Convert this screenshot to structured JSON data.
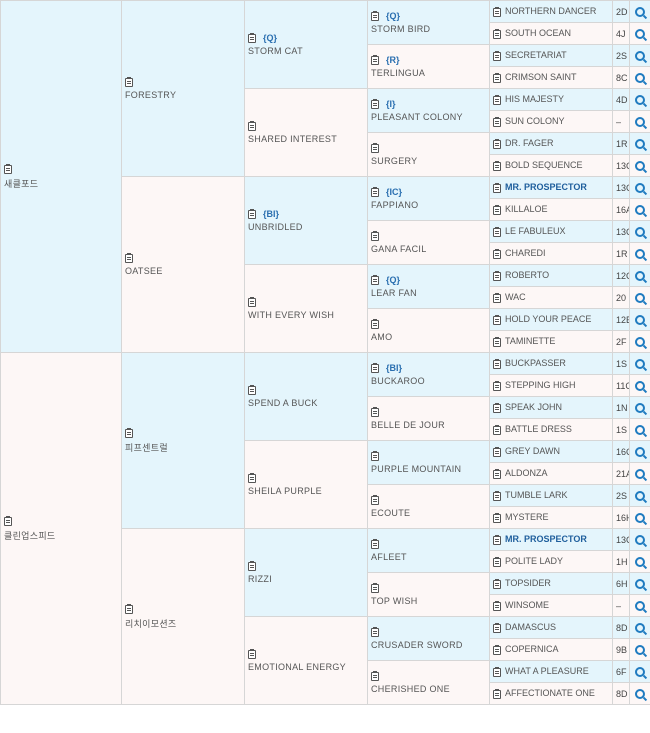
{
  "gen1": [
    {
      "name": "새클포드"
    },
    {
      "name": "클린업스피드"
    }
  ],
  "gen2": [
    {
      "name": "FORESTRY"
    },
    {
      "name": "OATSEE"
    },
    {
      "name": "피프센트럴"
    },
    {
      "name": "리치이모션즈"
    }
  ],
  "gen3": [
    {
      "name": "STORM CAT",
      "tag": "{Q}"
    },
    {
      "name": "SHARED INTEREST",
      "tag": ""
    },
    {
      "name": "UNBRIDLED",
      "tag": "{BI}"
    },
    {
      "name": "WITH EVERY WISH",
      "tag": ""
    },
    {
      "name": "SPEND A BUCK",
      "tag": ""
    },
    {
      "name": "SHEILA PURPLE",
      "tag": ""
    },
    {
      "name": "RIZZI",
      "tag": ""
    },
    {
      "name": "EMOTIONAL ENERGY",
      "tag": ""
    }
  ],
  "gen4": [
    {
      "name": "STORM BIRD",
      "tag": "{Q}"
    },
    {
      "name": "TERLINGUA",
      "tag": "{R}"
    },
    {
      "name": "PLEASANT COLONY",
      "tag": "{I}"
    },
    {
      "name": "SURGERY",
      "tag": ""
    },
    {
      "name": "FAPPIANO",
      "tag": "{IC}"
    },
    {
      "name": "GANA FACIL",
      "tag": ""
    },
    {
      "name": "LEAR FAN",
      "tag": "{Q}"
    },
    {
      "name": "AMO",
      "tag": ""
    },
    {
      "name": "BUCKAROO",
      "tag": "{BI}"
    },
    {
      "name": "BELLE DE JOUR",
      "tag": ""
    },
    {
      "name": "PURPLE MOUNTAIN",
      "tag": ""
    },
    {
      "name": "ECOUTE",
      "tag": ""
    },
    {
      "name": "AFLEET",
      "tag": ""
    },
    {
      "name": "TOP WISH",
      "tag": ""
    },
    {
      "name": "CRUSADER SWORD",
      "tag": ""
    },
    {
      "name": "CHERISHED ONE",
      "tag": ""
    }
  ],
  "gen5": [
    {
      "name": "NORTHERN DANCER",
      "code": "2D"
    },
    {
      "name": "SOUTH OCEAN",
      "code": "4J"
    },
    {
      "name": "SECRETARIAT",
      "code": "2S"
    },
    {
      "name": "CRIMSON SAINT",
      "code": "8C"
    },
    {
      "name": "HIS MAJESTY",
      "code": "4D"
    },
    {
      "name": "SUN COLONY",
      "code": "–"
    },
    {
      "name": "DR. FAGER",
      "code": "1R"
    },
    {
      "name": "BOLD SEQUENCE",
      "code": "13C"
    },
    {
      "name": "MR. PROSPECTOR",
      "code": "13C",
      "bold": true
    },
    {
      "name": "KILLALOE",
      "code": "16A"
    },
    {
      "name": "LE FABULEUX",
      "code": "13C"
    },
    {
      "name": "CHAREDI",
      "code": "1R"
    },
    {
      "name": "ROBERTO",
      "code": "12C"
    },
    {
      "name": "WAC",
      "code": "20"
    },
    {
      "name": "HOLD YOUR PEACE",
      "code": "12E"
    },
    {
      "name": "TAMINETTE",
      "code": "2F"
    },
    {
      "name": "BUCKPASSER",
      "code": "1S"
    },
    {
      "name": "STEPPING HIGH",
      "code": "11C"
    },
    {
      "name": "SPEAK JOHN",
      "code": "1N"
    },
    {
      "name": "BATTLE DRESS",
      "code": "1S"
    },
    {
      "name": "GREY DAWN",
      "code": "16C"
    },
    {
      "name": "ALDONZA",
      "code": "21A"
    },
    {
      "name": "TUMBLE LARK",
      "code": "2S"
    },
    {
      "name": "MYSTERE",
      "code": "16H"
    },
    {
      "name": "MR. PROSPECTOR",
      "code": "13C",
      "bold": true
    },
    {
      "name": "POLITE LADY",
      "code": "1H"
    },
    {
      "name": "TOPSIDER",
      "code": "6H"
    },
    {
      "name": "WINSOME",
      "code": "–"
    },
    {
      "name": "DAMASCUS",
      "code": "8D"
    },
    {
      "name": "COPERNICA",
      "code": "9B"
    },
    {
      "name": "WHAT A PLEASURE",
      "code": "6F"
    },
    {
      "name": "AFFECTIONATE ONE",
      "code": "8D"
    }
  ],
  "icons": {
    "notes": "clipboard-icon",
    "search": "magnifier-icon"
  },
  "colors": {
    "sire": "#e4f5fc",
    "dam": "#fdf7f6",
    "highlight": "#1e5e9c",
    "search": "#1f7bc0"
  }
}
